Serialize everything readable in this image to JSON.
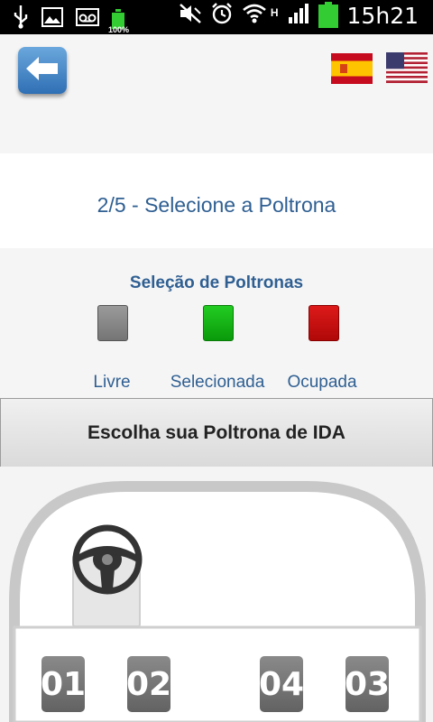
{
  "status_bar": {
    "time": "15h21",
    "battery_small_label": "100%",
    "network_label": "H",
    "icons": [
      "usb-icon",
      "image-icon",
      "voicemail-icon",
      "battery-small-icon",
      "mute-icon",
      "alarm-icon",
      "wifi-icon",
      "signal-icon",
      "battery-icon"
    ]
  },
  "header": {
    "back_icon": "back-arrow-icon",
    "flags": [
      "spain-flag-icon",
      "usa-flag-icon"
    ]
  },
  "step": {
    "text": "2/5 - Selecione a Poltrona"
  },
  "legend": {
    "title": "Seleção de Poltronas",
    "items": [
      {
        "label": "Livre",
        "color": "#8a8a8a"
      },
      {
        "label": "Selecionada",
        "color": "#10b810"
      },
      {
        "label": "Ocupada",
        "color": "#cc1111"
      }
    ]
  },
  "choose_button": {
    "label": "Escolha sua Poltrona de IDA"
  },
  "seats": [
    {
      "number": "01"
    },
    {
      "number": "02"
    },
    {
      "number": "04"
    },
    {
      "number": "03"
    }
  ],
  "colors": {
    "accent_text": "#2f5f92",
    "seat_free": "#7a7a7a"
  }
}
